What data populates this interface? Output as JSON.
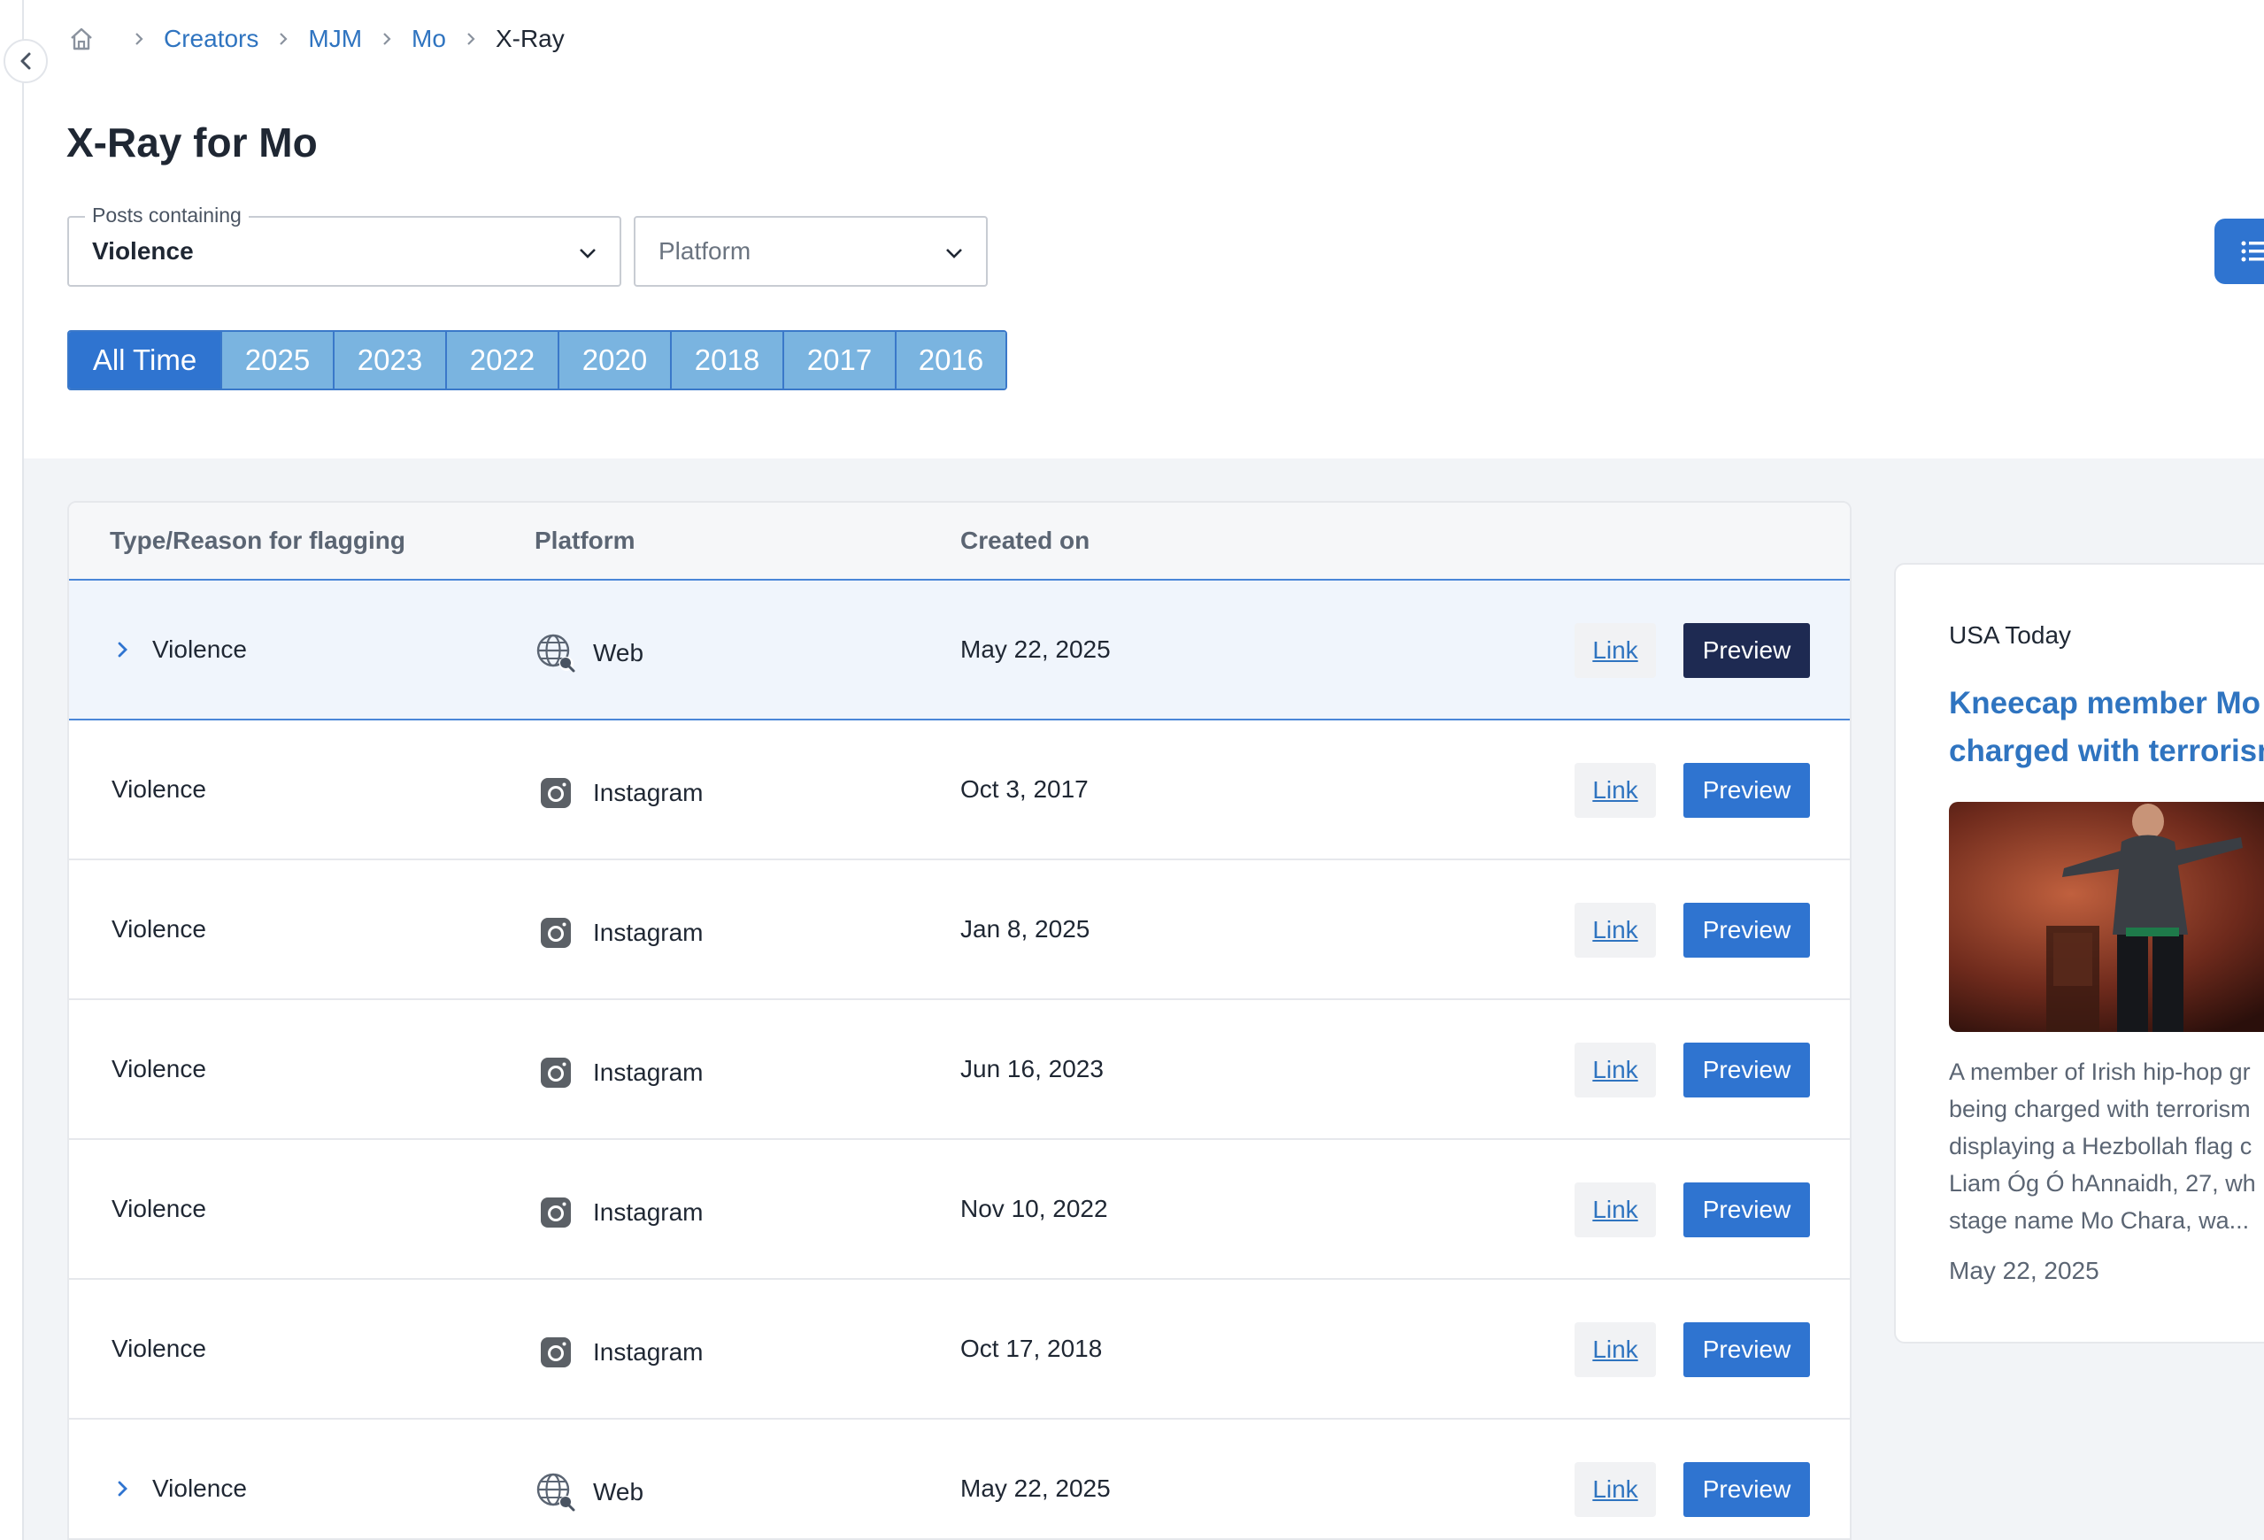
{
  "breadcrumb": {
    "items": [
      "Creators",
      "MJM",
      "Mo"
    ],
    "current": "X-Ray"
  },
  "page": {
    "title": "X-Ray for Mo"
  },
  "filters": {
    "posts_containing": {
      "label": "Posts containing",
      "value": "Violence"
    },
    "platform": {
      "placeholder": "Platform"
    }
  },
  "year_tabs": [
    "All Time",
    "2025",
    "2023",
    "2022",
    "2020",
    "2018",
    "2017",
    "2016"
  ],
  "active_year_tab": "All Time",
  "table": {
    "headers": {
      "type": "Type/Reason for flagging",
      "platform": "Platform",
      "created": "Created on"
    },
    "link_label": "Link",
    "preview_label": "Preview",
    "rows": [
      {
        "type": "Violence",
        "platform": "Web",
        "date": "May 22, 2025",
        "expandable": true,
        "selected": true
      },
      {
        "type": "Violence",
        "platform": "Instagram",
        "date": "Oct 3, 2017",
        "expandable": false,
        "selected": false
      },
      {
        "type": "Violence",
        "platform": "Instagram",
        "date": "Jan 8, 2025",
        "expandable": false,
        "selected": false
      },
      {
        "type": "Violence",
        "platform": "Instagram",
        "date": "Jun 16, 2023",
        "expandable": false,
        "selected": false
      },
      {
        "type": "Violence",
        "platform": "Instagram",
        "date": "Nov 10, 2022",
        "expandable": false,
        "selected": false
      },
      {
        "type": "Violence",
        "platform": "Instagram",
        "date": "Oct 17, 2018",
        "expandable": false,
        "selected": false
      },
      {
        "type": "Violence",
        "platform": "Web",
        "date": "May 22, 2025",
        "expandable": true,
        "selected": false
      }
    ]
  },
  "preview_card": {
    "source": "USA Today",
    "title_lines": [
      "Kneecap member Mo C",
      "charged with terrorism"
    ],
    "description_lines": [
      "A member of Irish hip-hop gr",
      "being charged with terrorism",
      "displaying a Hezbollah flag c",
      "Liam Óg Ó hAnnaidh, 27, wh",
      "stage name Mo Chara, wa..."
    ],
    "date": "May 22, 2025"
  },
  "icons": {
    "home": "home-icon",
    "collapse": "chevron-left-icon",
    "web": "globe-search-icon",
    "instagram": "instagram-icon",
    "list_view": "list-icon"
  },
  "colors": {
    "accent": "#2f74d0",
    "link": "#2f74c0",
    "dark_button": "#1e2a52",
    "tab_inactive": "#7ab4e0"
  }
}
